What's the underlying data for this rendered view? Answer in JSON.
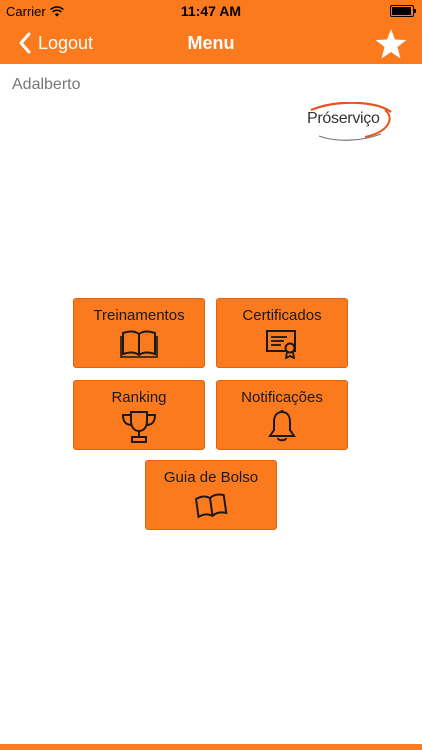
{
  "status_bar": {
    "carrier": "Carrier",
    "time": "11:47 AM"
  },
  "nav": {
    "back_label": "Logout",
    "title": "Menu"
  },
  "user": {
    "name": "Adalberto"
  },
  "logo": {
    "text_pro": "Pró",
    "text_rest": "serviço"
  },
  "tiles": [
    {
      "label": "Treinamentos",
      "icon": "open-book-icon"
    },
    {
      "label": "Certificados",
      "icon": "certificate-icon"
    },
    {
      "label": "Ranking",
      "icon": "trophy-icon"
    },
    {
      "label": "Notificações",
      "icon": "bell-icon"
    },
    {
      "label": "Guia de Bolso",
      "icon": "pocket-book-icon"
    }
  ],
  "colors": {
    "accent": "#fc7a1e",
    "tile_text": "#1a1a1a"
  }
}
